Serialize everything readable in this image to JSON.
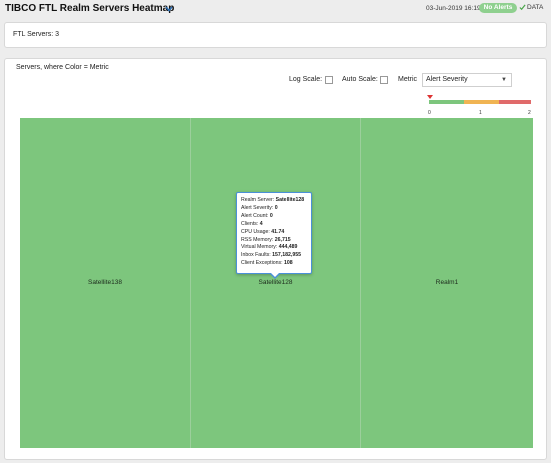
{
  "header": {
    "title": "TIBCO FTL Realm Servers Heatmap",
    "date": "03-Jun-2019 16:19",
    "alerts_badge": "No Alerts",
    "data_label": "DATA"
  },
  "summary": {
    "ftl_servers": "FTL Servers: 3"
  },
  "chart": {
    "title": "Servers, where Color = Metric",
    "log_scale_label": "Log Scale:",
    "auto_scale_label": "Auto Scale:",
    "metric_label": "Metric",
    "metric_value": "Alert Severity"
  },
  "legend": {
    "ticks": [
      "0",
      "1",
      "2"
    ],
    "colors": [
      "#7dc67d",
      "#f0b453",
      "#e06a6a"
    ]
  },
  "heatmap": {
    "cells": [
      {
        "label": "Satellite138"
      },
      {
        "label": "Satellite128"
      },
      {
        "label": "Realm1"
      }
    ],
    "fill_color": "#7dc67d"
  },
  "tooltip": {
    "rows": [
      {
        "k": "Realm Server:",
        "v": "Satellite128"
      },
      {
        "k": "Alert Severity:",
        "v": "0"
      },
      {
        "k": "Alert Count:",
        "v": "0"
      },
      {
        "k": "Clients:",
        "v": "4"
      },
      {
        "k": "CPU Usage:",
        "v": "41.74"
      },
      {
        "k": "RSS Memory:",
        "v": "26,715"
      },
      {
        "k": "Virtual Memory:",
        "v": "444,489"
      },
      {
        "k": "Inbox Faults:",
        "v": "157,182,955"
      },
      {
        "k": "Client Exceptions:",
        "v": "108"
      }
    ]
  }
}
